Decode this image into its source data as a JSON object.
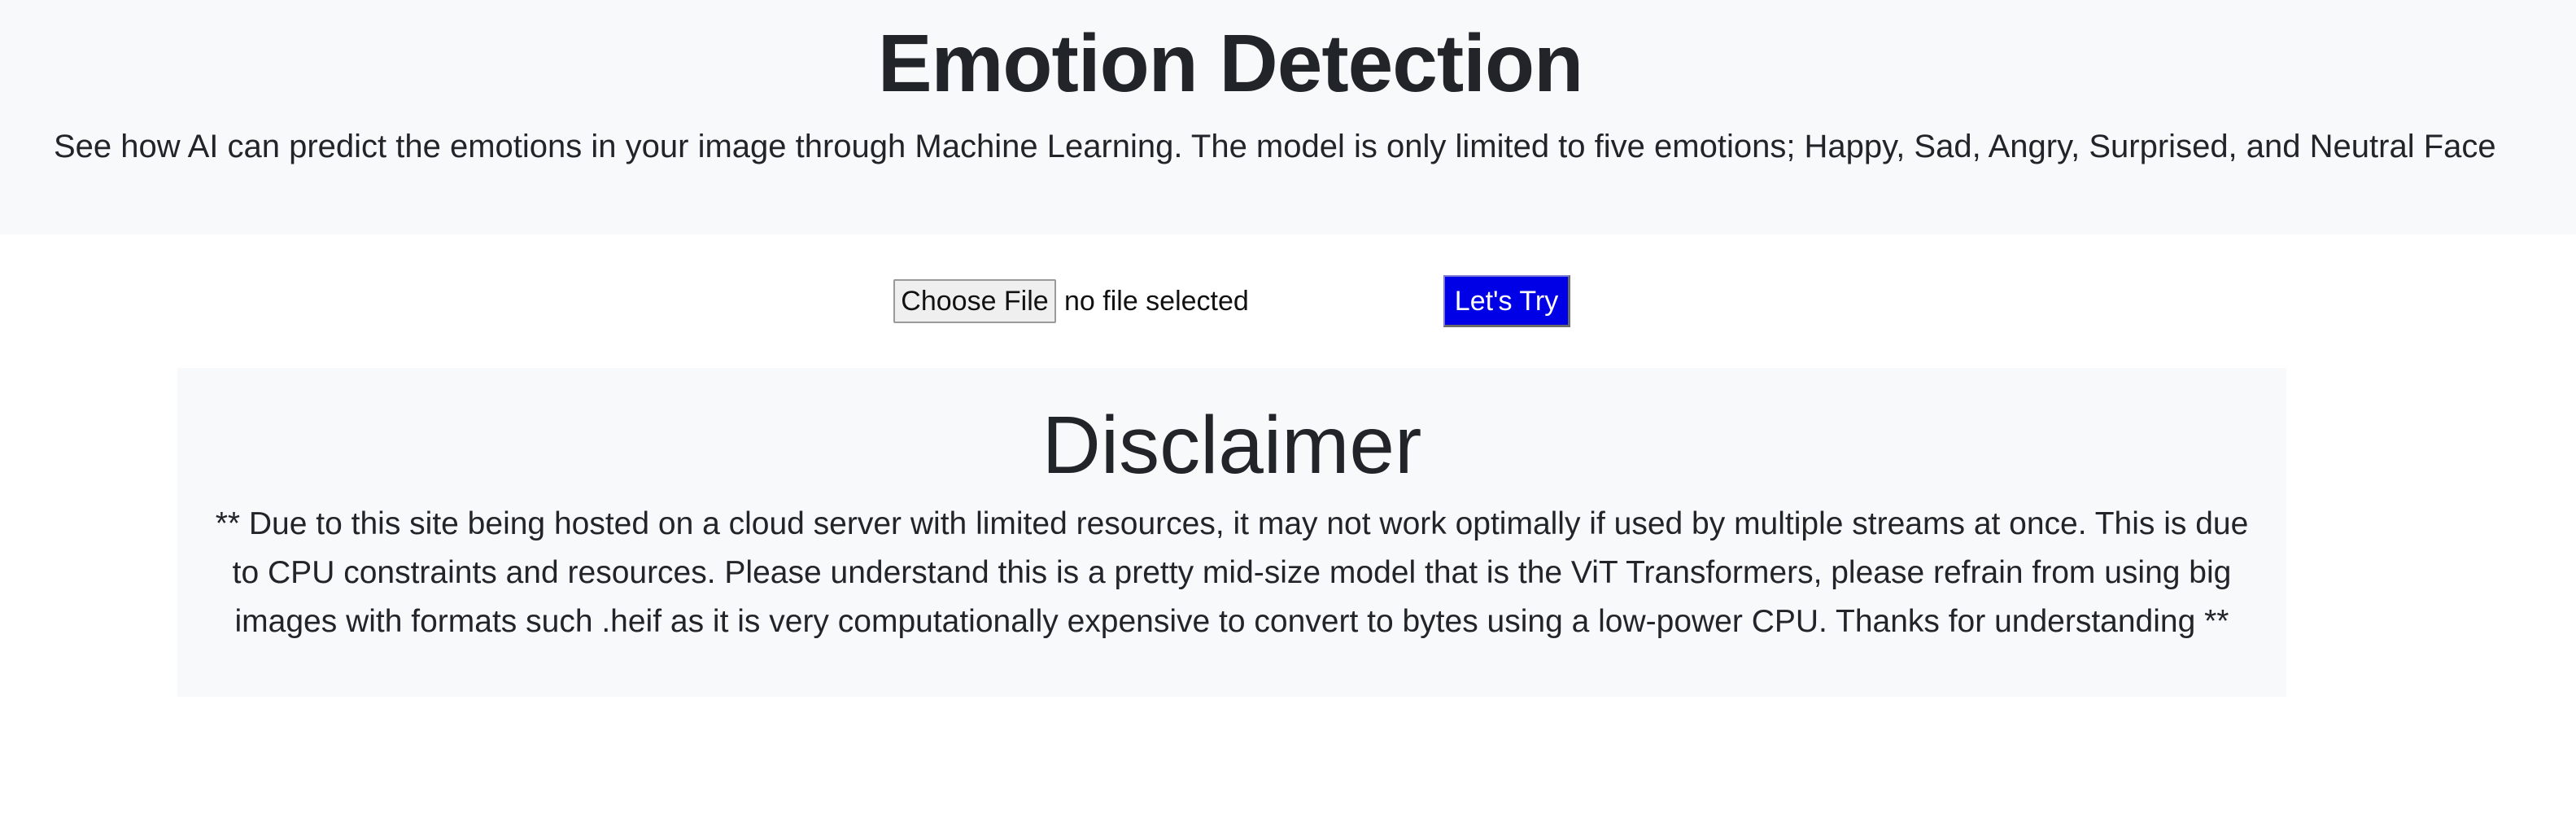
{
  "header": {
    "title": "Emotion Detection",
    "subtitle": "See how AI can predict the emotions in your image through Machine Learning. The model is only limited to five emotions; Happy, Sad, Angry, Surprised, and Neutral Face"
  },
  "upload": {
    "choose_file_label": "Choose File",
    "file_status": "no file selected",
    "submit_label": "Let's Try",
    "submit_color": "#0000e6"
  },
  "disclaimer": {
    "title": "Disclaimer",
    "text": "** Due to this site being hosted on a cloud server with limited resources, it may not work optimally if used by multiple streams at once. This is due to CPU constraints and resources. Please understand this is a pretty mid-size model that is the ViT Transformers, please refrain from using big images with formats such .heif as it is very computationally expensive to convert to bytes using a low-power CPU. Thanks for understanding **"
  },
  "colors": {
    "panel_background": "#f8f9fa",
    "text": "#212529"
  }
}
